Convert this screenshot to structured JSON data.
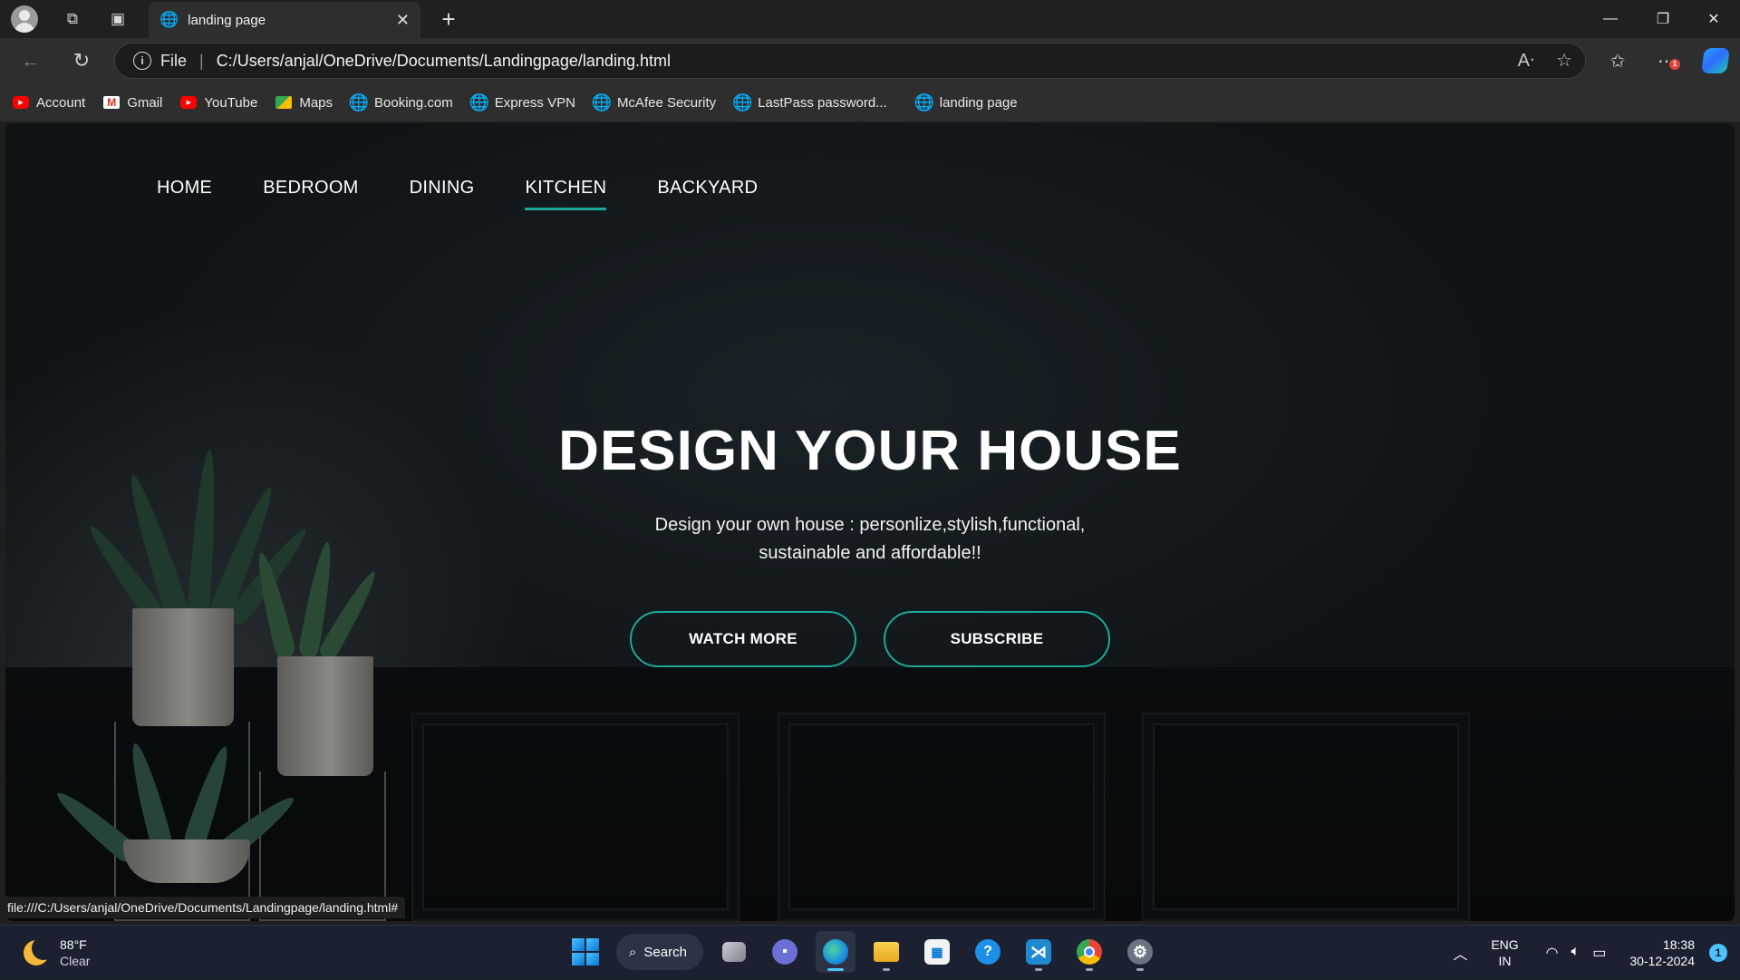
{
  "browser": {
    "tab": {
      "title": "landing page"
    },
    "address": {
      "scheme": "File",
      "url": "C:/Users/anjal/OneDrive/Documents/Landingpage/landing.html"
    },
    "bookmarks": [
      {
        "label": "Account",
        "icon": "youtube-icon"
      },
      {
        "label": "Gmail",
        "icon": "gmail-icon"
      },
      {
        "label": "YouTube",
        "icon": "youtube-icon"
      },
      {
        "label": "Maps",
        "icon": "maps-icon"
      },
      {
        "label": "Booking.com",
        "icon": "globe-icon"
      },
      {
        "label": "Express VPN",
        "icon": "globe-icon"
      },
      {
        "label": "McAfee Security",
        "icon": "globe-icon"
      },
      {
        "label": "LastPass password...",
        "icon": "globe-icon"
      },
      {
        "label": "landing page",
        "icon": "globe-icon"
      }
    ],
    "status_url": "file:///C:/Users/anjal/OneDrive/Documents/Landingpage/landing.html#",
    "notification_badge": "1"
  },
  "page": {
    "nav": [
      {
        "label": "HOME"
      },
      {
        "label": "BEDROOM"
      },
      {
        "label": "DINING"
      },
      {
        "label": "KITCHEN",
        "active": true
      },
      {
        "label": "BACKYARD"
      }
    ],
    "hero": {
      "title": "DESIGN YOUR HOUSE",
      "subtitle_line1": "Design your own house : personlize,stylish,functional,",
      "subtitle_line2": "sustainable and affordable!!"
    },
    "buttons": {
      "watch_more": "WATCH MORE",
      "subscribe": "SUBSCRIBE"
    },
    "colors": {
      "accent": "#1fa79a",
      "background": "#0d1113"
    }
  },
  "taskbar": {
    "weather": {
      "temp": "88°F",
      "condition": "Clear"
    },
    "search_label": "Search",
    "language": {
      "line1": "ENG",
      "line2": "IN"
    },
    "time": "18:38",
    "date": "30-12-2024",
    "notification_count": "1"
  }
}
